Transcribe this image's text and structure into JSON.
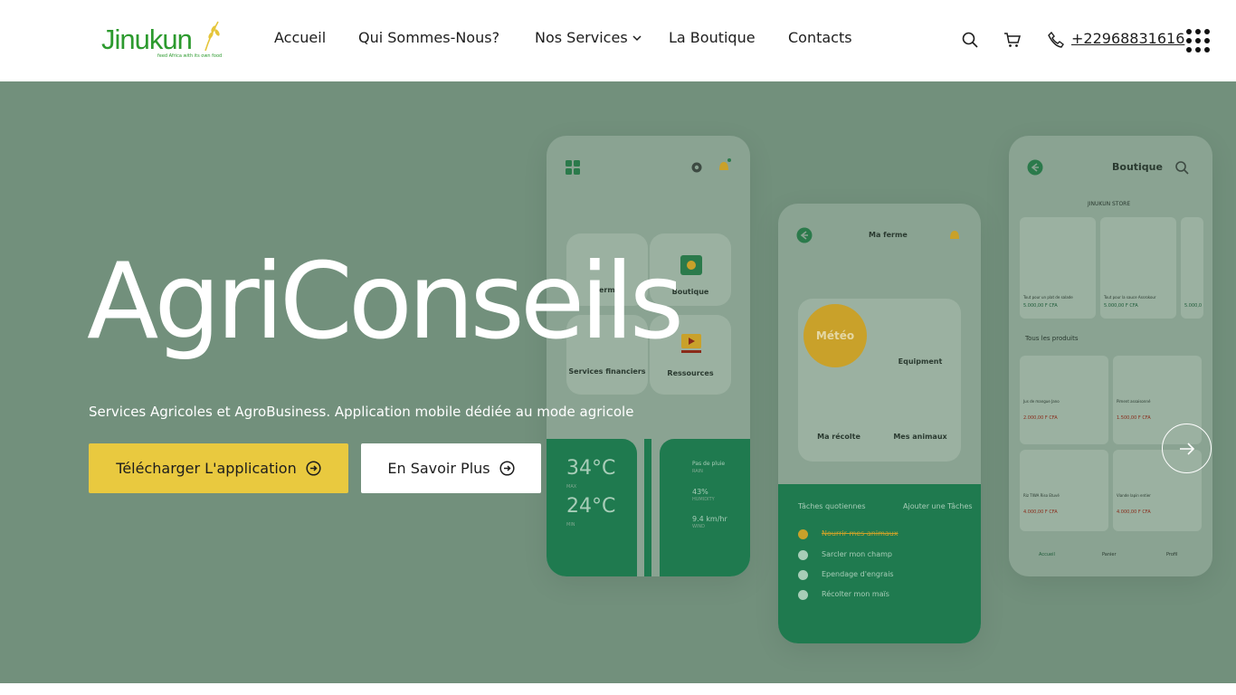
{
  "brand": {
    "name": "Jinukun",
    "tagline": "feed Africa with its own food"
  },
  "nav": {
    "items": [
      {
        "label": "Accueil"
      },
      {
        "label": "Qui Sommes-Nous?"
      },
      {
        "label": "Nos Services"
      },
      {
        "label": "La Boutique"
      },
      {
        "label": "Contacts"
      }
    ]
  },
  "header": {
    "phone": "+22968831616"
  },
  "hero": {
    "title": "AgriConseils",
    "subtitle": "Services Agricoles et AgroBusiness. Application mobile dédiée au mode agricole",
    "primary_button": "Télécharger L'application",
    "secondary_button": "En Savoir Plus"
  },
  "mockup1": {
    "tiles": [
      "Ferme",
      "Boutique",
      "Services financiers",
      "Ressources"
    ],
    "temp_max": "34°C",
    "temp_max_label": "MAX",
    "temp_min": "24°C",
    "temp_min_label": "MIN",
    "weather": [
      {
        "value": "Pas de pluie",
        "label": "RAIN"
      },
      {
        "value": "43%",
        "label": "HUMIDITY"
      },
      {
        "value": "9.4 km/hr",
        "label": "WIND"
      }
    ]
  },
  "mockup2": {
    "title": "Ma ferme",
    "weather_tile": "Météo",
    "tiles": [
      "Equipment",
      "Ma récolte",
      "Mes animaux"
    ],
    "tasks_title": "Tâches quotiennes",
    "add_task": "Ajouter une Tâches",
    "tasks": [
      "Nourrir mes animaux",
      "Sarcler mon champ",
      "Ependage d'engrais",
      "Récolter mon maïs"
    ]
  },
  "mockup3": {
    "title": "Boutique",
    "store": "JINUKUN STORE",
    "featured": [
      {
        "name": "Tout pour un plat de salade",
        "price": "5.000,00 F CFA"
      },
      {
        "name": "Tout pour la sauce Assrokour",
        "price": "5.000,00 F CFA"
      },
      {
        "name": "",
        "price": "5.000,0"
      }
    ],
    "all_products": "Tous les produits",
    "products": [
      {
        "name": "Jus de mangue Jano",
        "price": "2.000,00 F CFA"
      },
      {
        "name": "Piment assaisonné",
        "price": "1.500,00 F CFA"
      },
      {
        "name": "Riz TIWA Riso Etuvé",
        "price": "4.000,00 F CFA"
      },
      {
        "name": "Viande lapin entier",
        "price": "4.000,00 F CFA"
      }
    ],
    "tabs": [
      "Accueil",
      "Panier",
      "Profil"
    ]
  },
  "colors": {
    "accent": "#e9c93f",
    "brand_green": "#2c9a2e",
    "hero_bg": "#72907c"
  }
}
